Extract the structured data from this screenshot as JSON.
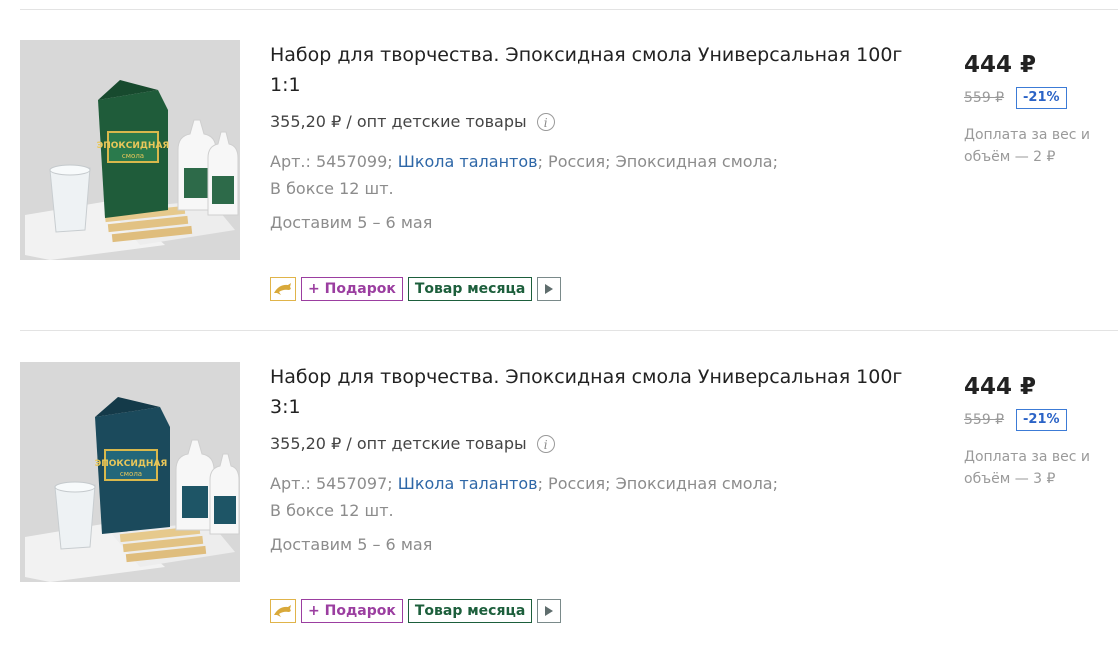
{
  "products": [
    {
      "image_alt": "Эпоксидная смола",
      "title": "Набор для творчества. Эпоксидная смола Универсальная 100г 1:1",
      "wholesale_price": "355,20 ₽ / опт детские товары",
      "art_label": "Арт.: 5457099;",
      "brand": "Школа талантов",
      "country_category": "; Россия; Эпоксидная смола;",
      "box_qty": "В боксе 12 шт.",
      "delivery": "Доставим 5 – 6 мая",
      "badges": {
        "gift": "+ Подарок",
        "month": "Товар месяца"
      },
      "price": "444 ₽",
      "old_price": "559 ₽",
      "discount": "-21%",
      "surcharge": "Доплата за вес и объём — 2 ₽",
      "pack_color": "#1f5c3a"
    },
    {
      "image_alt": "Эпоксидная смола",
      "title": "Набор для творчества. Эпоксидная смола Универсальная 100г 3:1",
      "wholesale_price": "355,20 ₽ / опт детские товары",
      "art_label": "Арт.: 5457097;",
      "brand": "Школа талантов",
      "country_category": "; Россия; Эпоксидная смола;",
      "box_qty": "В боксе 12 шт.",
      "delivery": "Доставим 5 – 6 мая",
      "badges": {
        "gift": "+ Подарок",
        "month": "Товар месяца"
      },
      "price": "444 ₽",
      "old_price": "559 ₽",
      "discount": "-21%",
      "surcharge": "Доплата за вес и объём — 3 ₽",
      "pack_color": "#1b4a5c"
    }
  ],
  "colors": {
    "link": "#2e67a7",
    "gift": "#9b3ea0",
    "month": "#1d5f3c",
    "discount": "#2b63c6"
  }
}
